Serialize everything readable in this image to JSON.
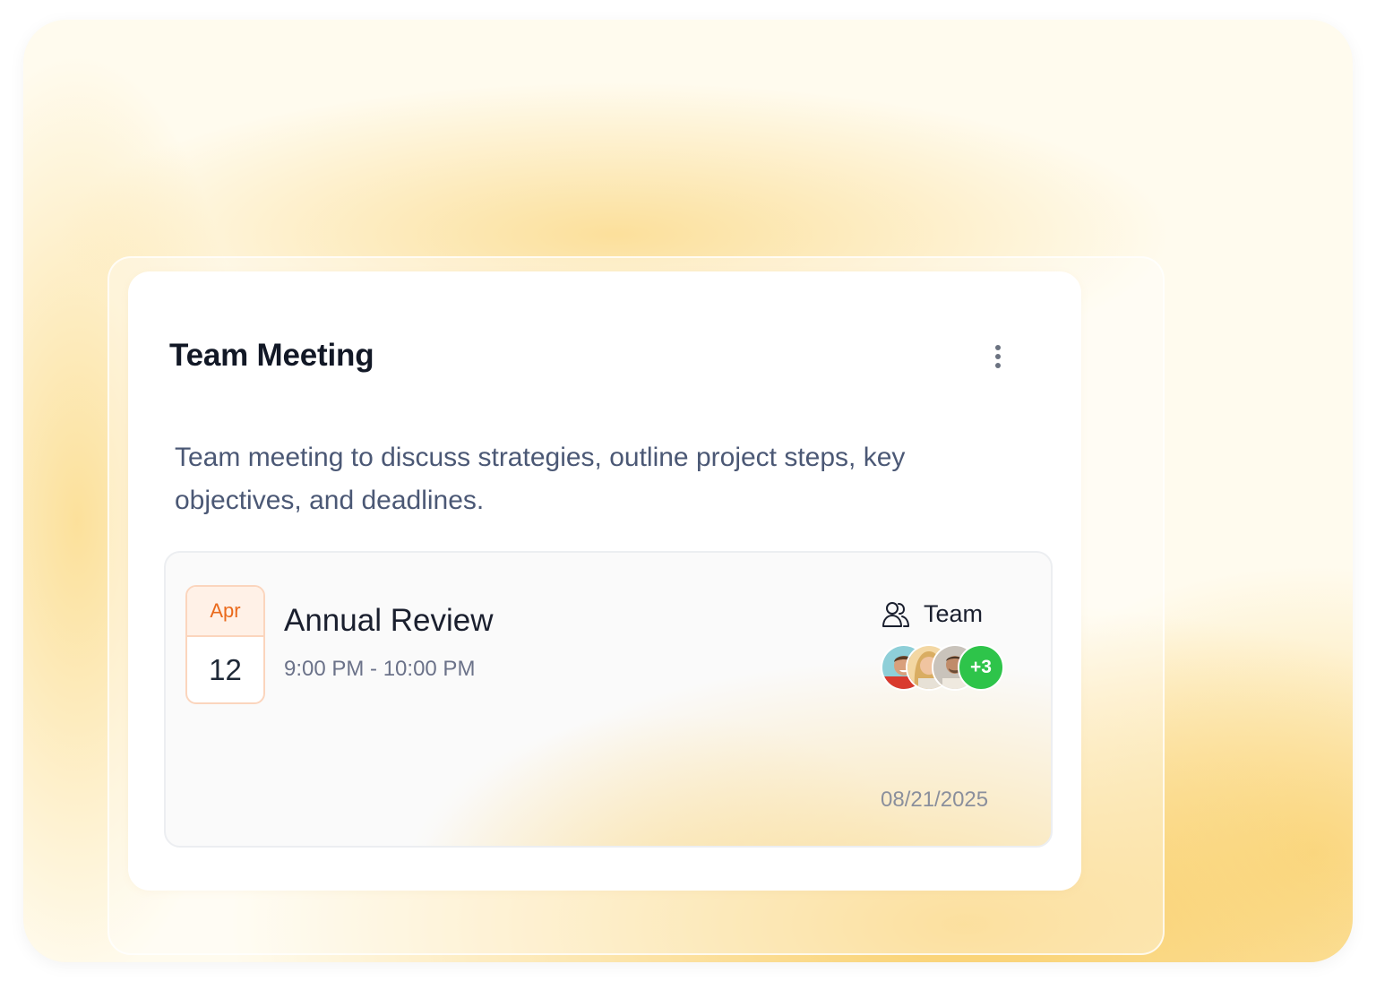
{
  "card": {
    "title": "Team Meeting",
    "description": "Team meeting to discuss strategies, outline project steps, key objectives, and deadlines."
  },
  "event": {
    "month": "Apr",
    "day": "12",
    "title": "Annual Review",
    "time": "9:00 PM - 10:00 PM",
    "group_label": "Team",
    "group_icon": "users-icon",
    "extra_attendees": "+3",
    "date": "08/21/2025"
  },
  "colors": {
    "accent_orange": "#ea6a1c",
    "attendee_badge_green": "#2ec44a",
    "background_warm": "#fffbee"
  }
}
